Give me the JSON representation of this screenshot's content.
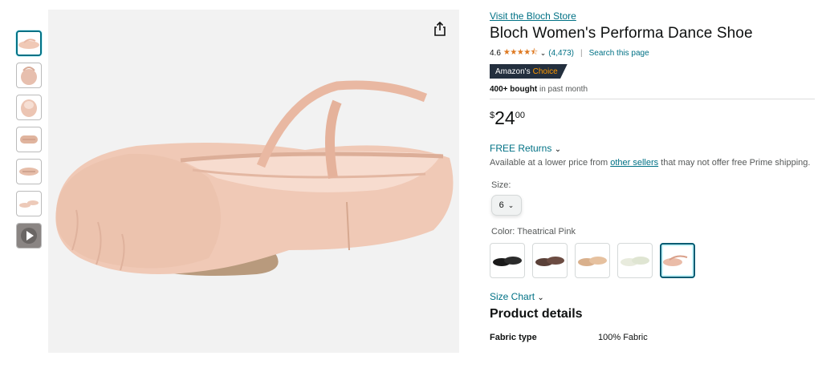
{
  "store_link": "Visit the Bloch Store",
  "title": "Bloch Women's Performa Dance Shoe",
  "rating": {
    "value": "4.6",
    "stars": "★★★★⯪",
    "count": "(4,473)",
    "search_page": "Search this page",
    "separator": "|"
  },
  "badge": {
    "prefix": "Amazon's",
    "suffix": "Choice"
  },
  "bought": {
    "strong": "400+ bought",
    "rest": " in past month"
  },
  "price": {
    "symbol": "$",
    "whole": "24",
    "fraction": "00"
  },
  "returns": "FREE Returns",
  "availability": {
    "before": "Available at a lower price from ",
    "link": "other sellers",
    "after": " that may not offer free Prime shipping."
  },
  "size": {
    "label": "Size:",
    "selected": "6"
  },
  "color": {
    "label": "Color: Theatrical Pink"
  },
  "size_chart": "Size Chart",
  "product_details": {
    "heading": "Product details",
    "rows": [
      {
        "key": "Fabric type",
        "value": "100% Fabric"
      }
    ]
  },
  "colors": {
    "link": "#007185",
    "star": "#de7921",
    "badge_bg": "#232f3e",
    "badge_accent": "#ff9900",
    "shoe_pink": "#f0c9b6"
  },
  "icons": {
    "share": "share-icon",
    "chevron": "chevron-down-icon",
    "play": "play-icon"
  }
}
